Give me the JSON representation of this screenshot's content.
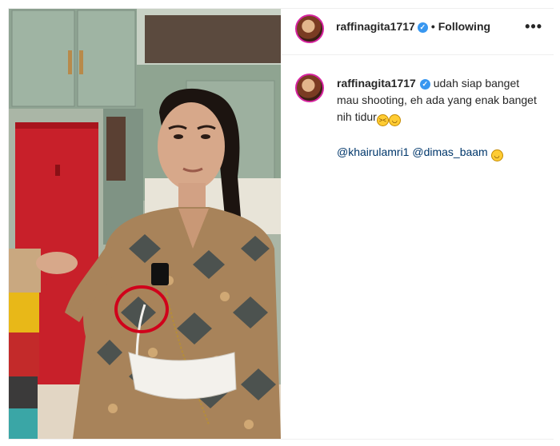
{
  "post": {
    "username": "raffinagita1717",
    "follow_status": "Following",
    "more_label": "•••",
    "dot": "•",
    "caption_text": "udah siap banget mau shooting, eh ada yang enak banget nih tidur",
    "mentions": [
      "@khairulamri1",
      "@dimas_baam"
    ]
  },
  "icons": {
    "verified": "verified-badge-icon",
    "more": "more-options-icon",
    "emoji_1": "grinning-squint-emoji",
    "emoji_2": "grinning-emoji",
    "emoji_3": "rolling-laughing-emoji"
  },
  "colors": {
    "verified_badge": "#3897f0",
    "mention_link": "#00376b",
    "highlight_circle": "#d0021b"
  }
}
